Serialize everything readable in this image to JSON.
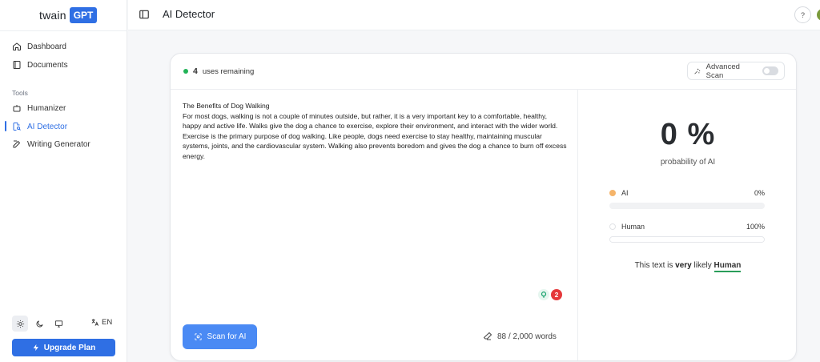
{
  "sidebar": {
    "logo_word": "twain",
    "logo_badge": "GPT",
    "items_top": [
      {
        "label": "Dashboard",
        "icon": "home-icon"
      },
      {
        "label": "Documents",
        "icon": "book-icon"
      }
    ],
    "section_label": "Tools",
    "items_tools": [
      {
        "label": "Humanizer",
        "icon": "robot-icon"
      },
      {
        "label": "AI Detector",
        "icon": "document-search-icon"
      },
      {
        "label": "Writing Generator",
        "icon": "edit-icon"
      }
    ],
    "language": "EN",
    "upgrade_label": "Upgrade Plan"
  },
  "header": {
    "title": "AI Detector",
    "help": "?"
  },
  "card": {
    "uses_count": "4",
    "uses_text": "uses remaining",
    "advanced_label": "Advanced Scan",
    "advanced_on": false,
    "editor_lines": [
      "The Benefits of Dog Walking",
      "For most dogs, walking is not a couple of minutes outside, but rather, it is a very important key to a comfortable, healthy, happy and active life. Walks give the dog a chance to exercise, explore their environment, and interact with the wider world.",
      "Exercise is the primary purpose of dog walking. Like people, dogs need exercise to stay healthy, maintaining muscular systems, joints, and the cardiovascular system. Walking also prevents boredom and gives the dog a chance to burn off excess energy."
    ],
    "issue_count": "2",
    "scan_label": "Scan for AI",
    "word_count": "88 / 2,000 words"
  },
  "results": {
    "percent": "0 %",
    "percent_caption": "probability of AI",
    "ai_label": "AI",
    "ai_value": "0%",
    "ai_fraction": 0,
    "human_label": "Human",
    "human_value": "100%",
    "human_fraction": 1,
    "verdict_prefix": "This text is",
    "verdict_strength": "very",
    "verdict_likely": "likely",
    "verdict_result": "Human"
  },
  "colors": {
    "accent": "#2f6fe4",
    "ai_swatch": "#f5b46a",
    "human_underline": "#2a9d5a",
    "uses_dot": "#22b357"
  }
}
